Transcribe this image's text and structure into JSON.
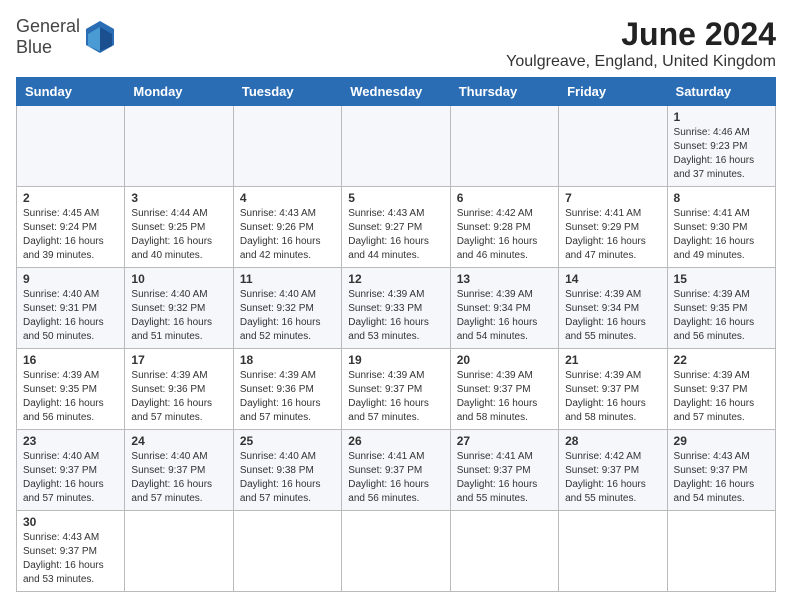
{
  "header": {
    "logo_text_line1": "General",
    "logo_text_line2": "Blue",
    "month_title": "June 2024",
    "location": "Youlgreave, England, United Kingdom"
  },
  "days_of_week": [
    "Sunday",
    "Monday",
    "Tuesday",
    "Wednesday",
    "Thursday",
    "Friday",
    "Saturday"
  ],
  "weeks": [
    [
      {
        "day": "",
        "info": ""
      },
      {
        "day": "",
        "info": ""
      },
      {
        "day": "",
        "info": ""
      },
      {
        "day": "",
        "info": ""
      },
      {
        "day": "",
        "info": ""
      },
      {
        "day": "",
        "info": ""
      },
      {
        "day": "1",
        "info": "Sunrise: 4:46 AM\nSunset: 9:23 PM\nDaylight: 16 hours and 37 minutes."
      }
    ],
    [
      {
        "day": "2",
        "info": "Sunrise: 4:45 AM\nSunset: 9:24 PM\nDaylight: 16 hours and 39 minutes."
      },
      {
        "day": "3",
        "info": "Sunrise: 4:44 AM\nSunset: 9:25 PM\nDaylight: 16 hours and 40 minutes."
      },
      {
        "day": "4",
        "info": "Sunrise: 4:43 AM\nSunset: 9:26 PM\nDaylight: 16 hours and 42 minutes."
      },
      {
        "day": "5",
        "info": "Sunrise: 4:43 AM\nSunset: 9:27 PM\nDaylight: 16 hours and 44 minutes."
      },
      {
        "day": "6",
        "info": "Sunrise: 4:42 AM\nSunset: 9:28 PM\nDaylight: 16 hours and 46 minutes."
      },
      {
        "day": "7",
        "info": "Sunrise: 4:41 AM\nSunset: 9:29 PM\nDaylight: 16 hours and 47 minutes."
      },
      {
        "day": "8",
        "info": "Sunrise: 4:41 AM\nSunset: 9:30 PM\nDaylight: 16 hours and 49 minutes."
      }
    ],
    [
      {
        "day": "9",
        "info": "Sunrise: 4:40 AM\nSunset: 9:31 PM\nDaylight: 16 hours and 50 minutes."
      },
      {
        "day": "10",
        "info": "Sunrise: 4:40 AM\nSunset: 9:32 PM\nDaylight: 16 hours and 51 minutes."
      },
      {
        "day": "11",
        "info": "Sunrise: 4:40 AM\nSunset: 9:32 PM\nDaylight: 16 hours and 52 minutes."
      },
      {
        "day": "12",
        "info": "Sunrise: 4:39 AM\nSunset: 9:33 PM\nDaylight: 16 hours and 53 minutes."
      },
      {
        "day": "13",
        "info": "Sunrise: 4:39 AM\nSunset: 9:34 PM\nDaylight: 16 hours and 54 minutes."
      },
      {
        "day": "14",
        "info": "Sunrise: 4:39 AM\nSunset: 9:34 PM\nDaylight: 16 hours and 55 minutes."
      },
      {
        "day": "15",
        "info": "Sunrise: 4:39 AM\nSunset: 9:35 PM\nDaylight: 16 hours and 56 minutes."
      }
    ],
    [
      {
        "day": "16",
        "info": "Sunrise: 4:39 AM\nSunset: 9:35 PM\nDaylight: 16 hours and 56 minutes."
      },
      {
        "day": "17",
        "info": "Sunrise: 4:39 AM\nSunset: 9:36 PM\nDaylight: 16 hours and 57 minutes."
      },
      {
        "day": "18",
        "info": "Sunrise: 4:39 AM\nSunset: 9:36 PM\nDaylight: 16 hours and 57 minutes."
      },
      {
        "day": "19",
        "info": "Sunrise: 4:39 AM\nSunset: 9:37 PM\nDaylight: 16 hours and 57 minutes."
      },
      {
        "day": "20",
        "info": "Sunrise: 4:39 AM\nSunset: 9:37 PM\nDaylight: 16 hours and 58 minutes."
      },
      {
        "day": "21",
        "info": "Sunrise: 4:39 AM\nSunset: 9:37 PM\nDaylight: 16 hours and 58 minutes."
      },
      {
        "day": "22",
        "info": "Sunrise: 4:39 AM\nSunset: 9:37 PM\nDaylight: 16 hours and 57 minutes."
      }
    ],
    [
      {
        "day": "23",
        "info": "Sunrise: 4:40 AM\nSunset: 9:37 PM\nDaylight: 16 hours and 57 minutes."
      },
      {
        "day": "24",
        "info": "Sunrise: 4:40 AM\nSunset: 9:37 PM\nDaylight: 16 hours and 57 minutes."
      },
      {
        "day": "25",
        "info": "Sunrise: 4:40 AM\nSunset: 9:38 PM\nDaylight: 16 hours and 57 minutes."
      },
      {
        "day": "26",
        "info": "Sunrise: 4:41 AM\nSunset: 9:37 PM\nDaylight: 16 hours and 56 minutes."
      },
      {
        "day": "27",
        "info": "Sunrise: 4:41 AM\nSunset: 9:37 PM\nDaylight: 16 hours and 55 minutes."
      },
      {
        "day": "28",
        "info": "Sunrise: 4:42 AM\nSunset: 9:37 PM\nDaylight: 16 hours and 55 minutes."
      },
      {
        "day": "29",
        "info": "Sunrise: 4:43 AM\nSunset: 9:37 PM\nDaylight: 16 hours and 54 minutes."
      }
    ],
    [
      {
        "day": "30",
        "info": "Sunrise: 4:43 AM\nSunset: 9:37 PM\nDaylight: 16 hours and 53 minutes."
      },
      {
        "day": "",
        "info": ""
      },
      {
        "day": "",
        "info": ""
      },
      {
        "day": "",
        "info": ""
      },
      {
        "day": "",
        "info": ""
      },
      {
        "day": "",
        "info": ""
      },
      {
        "day": "",
        "info": ""
      }
    ]
  ]
}
